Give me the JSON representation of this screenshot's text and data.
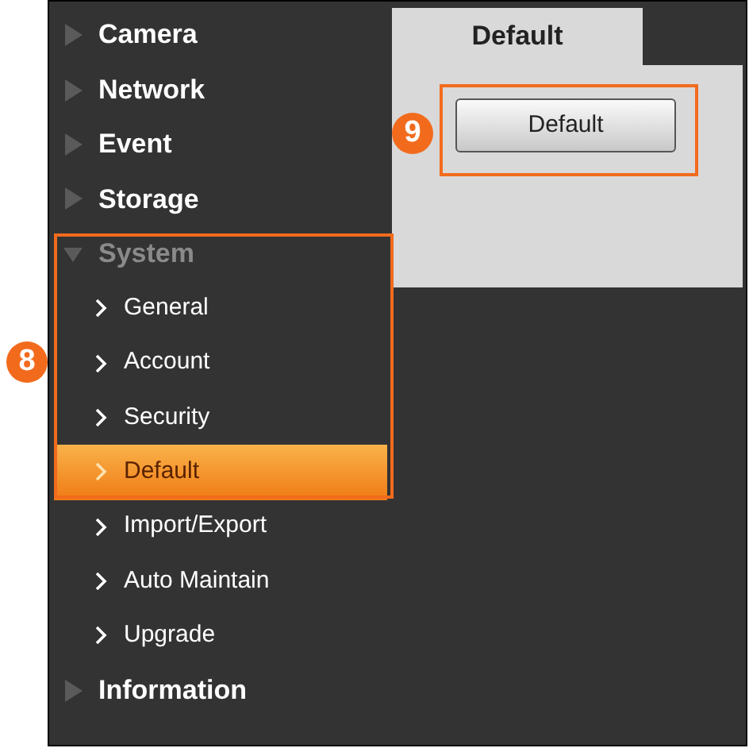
{
  "menu": [
    {
      "label": "Camera",
      "expanded": false
    },
    {
      "label": "Network",
      "expanded": false
    },
    {
      "label": "Event",
      "expanded": false
    },
    {
      "label": "Storage",
      "expanded": false
    },
    {
      "label": "System",
      "expanded": true,
      "children": [
        {
          "label": "General",
          "selected": false
        },
        {
          "label": "Account",
          "selected": false
        },
        {
          "label": "Security",
          "selected": false
        },
        {
          "label": "Default",
          "selected": true
        },
        {
          "label": "Import/Export",
          "selected": false
        },
        {
          "label": "Auto Maintain",
          "selected": false
        },
        {
          "label": "Upgrade",
          "selected": false
        }
      ]
    },
    {
      "label": "Information",
      "expanded": false
    }
  ],
  "tab": {
    "label": "Default",
    "selected": true
  },
  "button": {
    "label": "Default"
  },
  "callouts": [
    {
      "number": "8"
    },
    {
      "number": "9"
    }
  ]
}
